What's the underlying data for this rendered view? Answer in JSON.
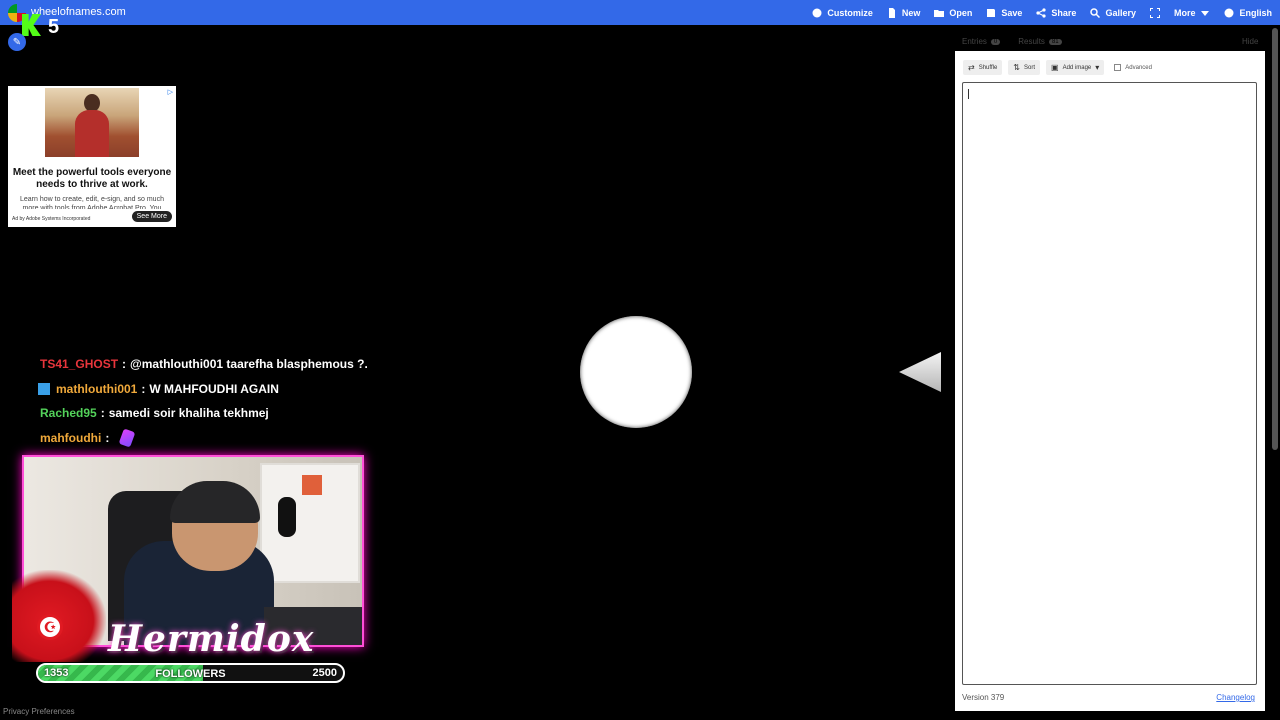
{
  "header": {
    "site_name": "wheelofnames.com",
    "nav": [
      {
        "icon": "palette-icon",
        "label": "Customize"
      },
      {
        "icon": "file-icon",
        "label": "New"
      },
      {
        "icon": "folder-icon",
        "label": "Open"
      },
      {
        "icon": "save-icon",
        "label": "Save"
      },
      {
        "icon": "share-icon",
        "label": "Share"
      },
      {
        "icon": "search-icon",
        "label": "Gallery"
      },
      {
        "icon": "fullscreen-icon",
        "label": ""
      },
      {
        "icon": "chevron-down-icon",
        "label": "More"
      },
      {
        "icon": "globe-icon",
        "label": "English"
      }
    ],
    "brand_color": "#3369e8"
  },
  "kick": {
    "viewer_count": "5",
    "brand_color": "#53fc18"
  },
  "ad": {
    "headline": "Meet the powerful tools everyone needs to thrive at work.",
    "body": "Learn how to create, edit, e-sign, and so much more with tools from Adobe Acrobat Pro. You",
    "advertiser": "Ad by Adobe Systems Incorporated",
    "cta": "See More"
  },
  "chat": [
    {
      "user": "TS41_GHOST",
      "color": "#e8353c",
      "message": "@mathlouthi001 taarefha blasphemous ?.",
      "badge": false,
      "emote": false
    },
    {
      "user": "mathlouthi001",
      "color": "#f0a93b",
      "message": "W MAHFOUDHI AGAIN",
      "badge": true,
      "emote": false
    },
    {
      "user": "Rached95",
      "color": "#53d25a",
      "message": "samedi soir khaliha tekhmej",
      "badge": false,
      "emote": false
    },
    {
      "user": "mahfoudhi",
      "color": "#f0a93b",
      "message": "",
      "badge": false,
      "emote": true
    }
  ],
  "streamer": {
    "name": "Hermidox"
  },
  "followers": {
    "current": "1353",
    "label": "FOLLOWERS",
    "goal": "2500",
    "progress": 0.5412
  },
  "footer": {
    "privacy": "Privacy Preferences"
  },
  "panel": {
    "tabs": [
      {
        "label": "Entries",
        "count": "0"
      },
      {
        "label": "Results",
        "count": "81"
      }
    ],
    "hide_label": "Hide",
    "toolbar": {
      "shuffle": "Shuffle",
      "sort": "Sort",
      "add_image": "Add image",
      "advanced": "Advanced"
    },
    "entries_value": "",
    "version": "Version 379",
    "changelog": "Changelog"
  }
}
